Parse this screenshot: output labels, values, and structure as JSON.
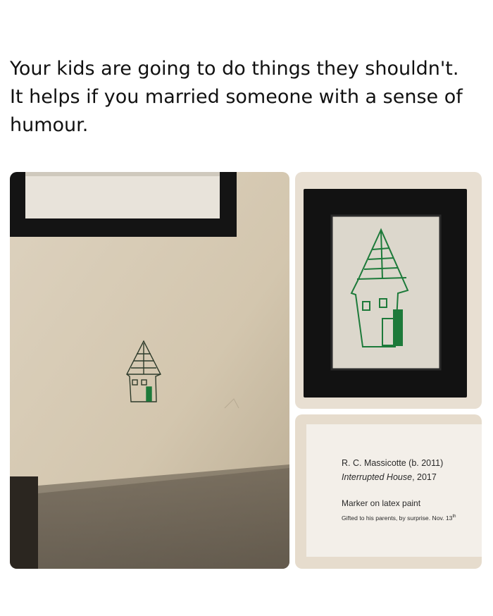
{
  "post": {
    "caption": "Your kids are going to do things they shouldn't. It helps if you married someone with a sense of humour."
  },
  "museum_label": {
    "artist": "R. C. Massicotte (b. 2011)",
    "title": "Interrupted House",
    "year": ", 2017",
    "medium": "Marker on latex paint",
    "credit": "Gifted to his parents, by surprise. Nov. 13",
    "credit_sup": "th"
  },
  "colors": {
    "wall": "#d9cdb8",
    "frame": "#141414",
    "marker_green": "#1d7a3a",
    "label_card": "#f3efe9"
  }
}
